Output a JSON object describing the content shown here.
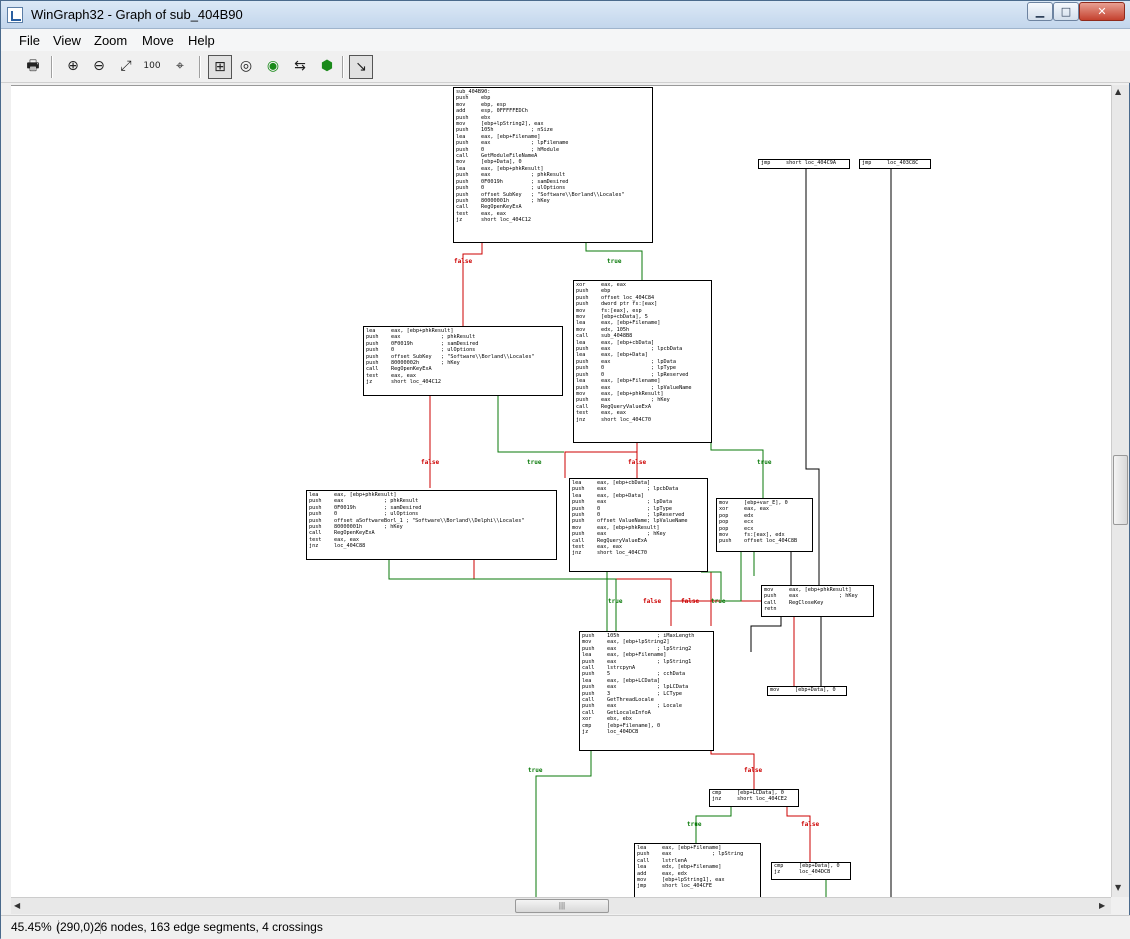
{
  "window": {
    "title": "WinGraph32 - Graph of sub_404B90",
    "min_label": "▁",
    "max_label": "□",
    "close_label": "✕"
  },
  "menu": {
    "file": "File",
    "view": "View",
    "zoom": "Zoom",
    "move": "Move",
    "help": "Help"
  },
  "toolbar": {
    "print": "🖶",
    "zoom_in": "⊕",
    "zoom_out": "⊖",
    "fit": "⤢",
    "zoom_100": "100",
    "center": "⌖",
    "mode_move": "⊞",
    "mode_a": "◎",
    "mode_b": "◉",
    "mode_c": "⇆",
    "mode_d": "⬢",
    "select": "↘"
  },
  "status": {
    "zoom": "45.45%",
    "coords": "(290,0)",
    "info": "26 nodes, 163 edge segments, 4 crossings"
  },
  "edges": {
    "true_label": "true",
    "false_label": "false",
    "true_color": "#0a7a0a",
    "false_color": "#cc0000"
  },
  "nodes": {
    "n_top": "sub_404B90:\npush    ebp\nmov     ebp, esp\nadd     esp, 0FFFFFEDCh\npush    ebx\nmov     [ebp+lpString2], eax\npush    105h            ; nSize\nlea     eax, [ebp+Filename]\npush    eax             ; lpFilename\npush    0               ; hModule\ncall    GetModuleFileNameA\nmov     [ebp+Data], 0\nlea     eax, [ebp+phkResult]\npush    eax             ; phkResult\npush    0F0019h         ; samDesired\npush    0               ; ulOptions\npush    offset SubKey   ; \"Software\\\\Borland\\\\Locales\"\npush    80000001h       ; hKey\ncall    RegOpenKeyExA\ntest    eax, eax\njz      short loc_404C12",
    "n_jmp1": "jmp     short loc_404C9A",
    "n_jmp2": "jmp     loc_403C8C",
    "n_mid": "xor     eax, eax\npush    ebp\npush    offset loc_404C84\npush    dword ptr fs:[eax]\nmov     fs:[eax], esp\nmov     [ebp+cbData], 5\nlea     eax, [ebp+Filename]\nmov     edx, 105h\ncall    sub_4048B8\nlea     eax, [ebp+cbData]\npush    eax             ; lpcbData\nlea     eax, [ebp+Data]\npush    eax             ; lpData\npush    0               ; lpType\npush    0               ; lpReserved\nlea     eax, [ebp+Filename]\npush    eax             ; lpValueName\nmov     eax, [ebp+phkResult]\npush    eax             ; hKey\ncall    RegQueryValueExA\ntest    eax, eax\njnz     short loc_404C70",
    "n_left1": "lea     eax, [ebp+phkResult]\npush    eax             ; phkResult\npush    0F0019h         ; samDesired\npush    0               ; ulOptions\npush    offset SubKey   ; \"Software\\\\Borland\\\\Locales\"\npush    80000002h       ; hKey\ncall    RegOpenKeyExA\ntest    eax, eax\njz      short loc_404C12",
    "n_left2": "lea     eax, [ebp+phkResult]\npush    eax             ; phkResult\npush    0F0019h         ; samDesired\npush    0               ; ulOptions\npush    offset aSoftwareBorl_1 ; \"Software\\\\Borland\\\\Delphi\\\\Locales\"\npush    80000001h       ; hKey\ncall    RegOpenKeyExA\ntest    eax, eax\njnz     loc_404C88",
    "n_midq": "lea     eax, [ebp+cbData]\npush    eax             ; lpcbData\nlea     eax, [ebp+Data]\npush    eax             ; lpData\npush    0               ; lpType\npush    0               ; lpReserved\npush    offset ValueName; lpValueName\nmov     eax, [ebp+phkResult]\npush    eax             ; hKey\ncall    RegQueryValueExA\ntest    eax, eax\njnz     short loc_404C70",
    "n_right1": "mov     [ebp+var_E], 0\nxor     eax, eax\npop     edx\npop     ecx\npop     ecx\nmov     fs:[eax], edx\npush    offset loc_404C8B",
    "n_close": "mov     eax, [ebp+phkResult]\npush    eax             ; hKey\ncall    RegCloseKey\nretn",
    "n_movdata": "mov     [ebp+Data], 0",
    "n_locale": "push    105h            ; iMaxLength\nmov     eax, [ebp+lpString2]\npush    eax             ; lpString2\nlea     eax, [ebp+Filename]\npush    eax             ; lpString1\ncall    lstrcpynA\npush    5               ; cchData\nlea     eax, [ebp+LCData]\npush    eax             ; lpLCData\npush    3               ; LCType\ncall    GetThreadLocale\npush    eax             ; Locale\ncall    GetLocaleInfoA\nxor     ebx, ebx\ncmp     [ebp+Filename], 0\njz      loc_404DCB",
    "n_cmp1": "cmp     [ebp+LCData], 0\njnz     short loc_404CE2",
    "n_lstr": "lea     eax, [ebp+Filename]\npush    eax             ; lpString\ncall    lstrlenA\nlea     edx, [ebp+Filename]\nadd     eax, edx\nmov     [ebp+lpString1], eax\njmp     short loc_404CFE",
    "n_cmp2": "cmp     [ebp+Data], 0\njz      loc_404DCB"
  }
}
